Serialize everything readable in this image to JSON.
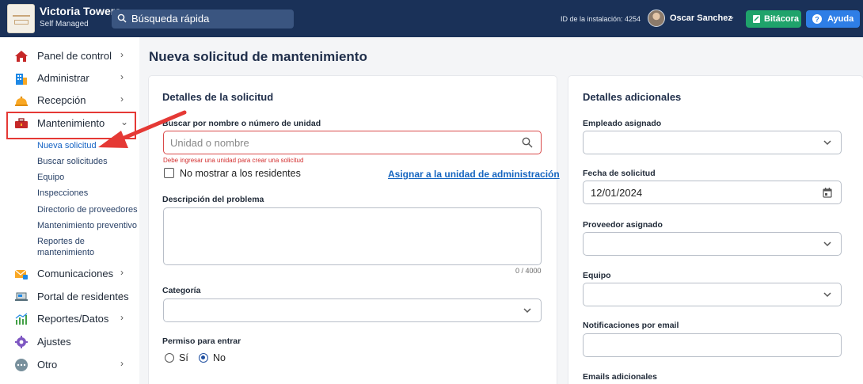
{
  "header": {
    "brand_name": "Victoria Towers",
    "brand_sub": "Self Managed",
    "search_placeholder": "Búsqueda rápida",
    "install_id": "ID de la instalación: 4254",
    "user_name": "Oscar Sanchez",
    "bitacora_label": "Bitácora",
    "ayuda_label": "Ayuda"
  },
  "sidebar": {
    "items": [
      {
        "label": "Panel de control",
        "icon": "house-icon"
      },
      {
        "label": "Administrar",
        "icon": "building-icon"
      },
      {
        "label": "Recepción",
        "icon": "bell-icon"
      },
      {
        "label": "Mantenimiento",
        "icon": "toolbox-icon"
      },
      {
        "label": "Comunicaciones",
        "icon": "envelope-icon"
      },
      {
        "label": "Portal de residentes",
        "icon": "laptop-icon"
      },
      {
        "label": "Reportes/Datos",
        "icon": "chart-icon"
      },
      {
        "label": "Ajustes",
        "icon": "gear-icon"
      },
      {
        "label": "Otro",
        "icon": "dots-icon"
      }
    ],
    "sub_items": [
      "Nueva solicitud",
      "Buscar solicitudes",
      "Equipo",
      "Inspecciones",
      "Directorio de proveedores",
      "Mantenimiento preventivo",
      "Reportes de",
      "mantenimiento"
    ]
  },
  "main": {
    "page_title": "Nueva solicitud de mantenimiento",
    "left": {
      "section_title": "Detalles de la solicitud",
      "unit_label": "Buscar por nombre o número de unidad",
      "unit_placeholder": "Unidad o nombre",
      "unit_error": "Debe ingresar una unidad para crear una solicitud",
      "hide_residents_label": "No mostrar a los residentes",
      "assign_admin_link": "Asignar a la unidad de administración",
      "problem_label": "Descripción del problema",
      "problem_counter": "0 / 4000",
      "category_label": "Categoría",
      "permission_label": "Permiso para entrar",
      "permission_yes": "Sí",
      "permission_no": "No"
    },
    "right": {
      "section_title": "Detalles adicionales",
      "employee_label": "Empleado asignado",
      "date_label": "Fecha de solicitud",
      "date_value": "12/01/2024",
      "vendor_label": "Proveedor asignado",
      "equipment_label": "Equipo",
      "email_notif_label": "Notificaciones por email",
      "extra_emails_label": "Emails adicionales"
    }
  },
  "colors": {
    "topbar": "#1a3158",
    "bitacora": "#1fa36b",
    "ayuda": "#2e7ee6",
    "annotation_red": "#e53935"
  }
}
